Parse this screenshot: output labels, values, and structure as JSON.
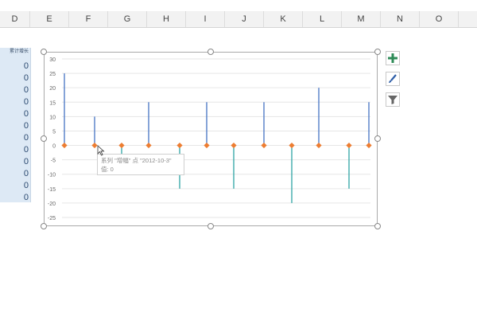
{
  "columns": [
    "D",
    "E",
    "F",
    "G",
    "H",
    "I",
    "J",
    "K",
    "L",
    "M",
    "N",
    "O"
  ],
  "cells": {
    "header": "累计增长",
    "values": [
      "0",
      "0",
      "0",
      "0",
      "0",
      "0",
      "0",
      "0",
      "0",
      "0",
      "0",
      "0"
    ]
  },
  "chart_data": {
    "type": "scatter",
    "y_ticks": [
      "30",
      "25",
      "20",
      "15",
      "10",
      "5",
      "0",
      "-5",
      "-10",
      "-15",
      "-20",
      "-25"
    ],
    "ylim": [
      -25,
      30
    ],
    "points": [
      {
        "y": 0,
        "line_top": 25,
        "line_bottom": 0
      },
      {
        "y": 0,
        "line_top": 10,
        "line_bottom": 0
      },
      {
        "y": 0,
        "line_top": 0,
        "line_bottom": -10
      },
      {
        "y": 0,
        "line_top": 15,
        "line_bottom": 0
      },
      {
        "y": 0,
        "line_top": 0,
        "line_bottom": -15
      },
      {
        "y": 0,
        "line_top": 15,
        "line_bottom": 0
      },
      {
        "y": 0,
        "line_top": 0,
        "line_bottom": -15
      },
      {
        "y": 0,
        "line_top": 15,
        "line_bottom": 0
      },
      {
        "y": 0,
        "line_top": 0,
        "line_bottom": -20
      },
      {
        "y": 0,
        "line_top": 20,
        "line_bottom": 0
      },
      {
        "y": 0,
        "line_top": 0,
        "line_bottom": -15
      },
      {
        "y": 0,
        "line_top": 15,
        "line_bottom": 0
      }
    ],
    "marker_color": "#ed7d31",
    "line_color_up": "#4472c4",
    "line_color_down": "#2ea3a3",
    "grid": true
  },
  "tooltip": {
    "line1": "系列 \"增幅\" 点 \"2012-10-3\"",
    "line2": "值: 0"
  },
  "side_buttons": [
    {
      "icon": "plus-icon",
      "color": "#2e8b57"
    },
    {
      "icon": "brush-icon",
      "color": "#2f5fa8"
    },
    {
      "icon": "filter-icon",
      "color": "#555555"
    }
  ]
}
